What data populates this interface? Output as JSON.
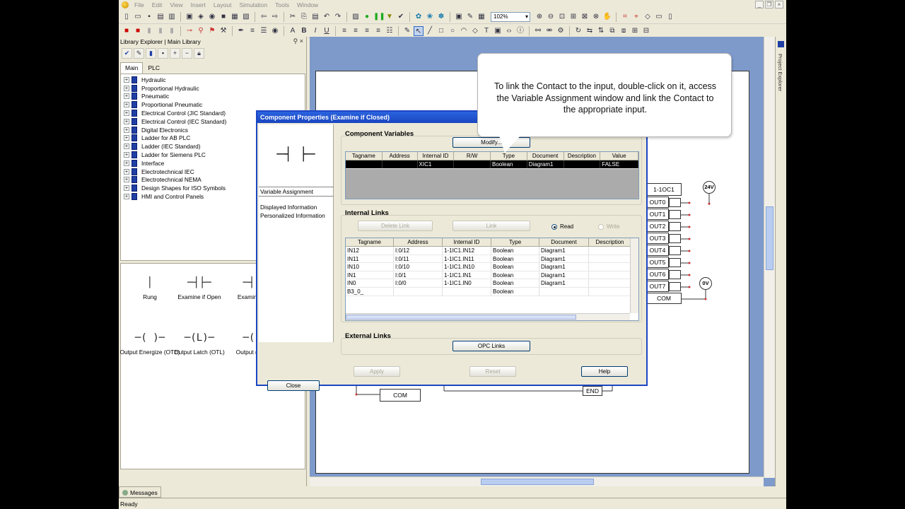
{
  "menu": [
    "File",
    "Edit",
    "View",
    "Insert",
    "Layout",
    "Simulation",
    "Tools",
    "Window"
  ],
  "toolbar": {
    "zoom": "102%"
  },
  "library": {
    "title": "Library Explorer | Main Library",
    "tabs": [
      "Main",
      "PLC"
    ],
    "tree": [
      "Hydraulic",
      "Proportional Hydraulic",
      "Pneumatic",
      "Proportional Pneumatic",
      "Electrical Control (JIC Standard)",
      "Electrical Control (IEC Standard)",
      "Digital Electronics",
      "Ladder for AB PLC",
      "Ladder (IEC Standard)",
      "Ladder for Siemens PLC",
      "Interface",
      "Electrotechnical IEC",
      "Electrotechnical NEMA",
      "Design Shapes for ISO Symbols",
      "HMI and Control Panels"
    ],
    "shapes": [
      {
        "label": "Rung",
        "symbol": "│"
      },
      {
        "label": "Examine if Open",
        "symbol": "─┤├─"
      },
      {
        "label": "Examine",
        "symbol": "─┤"
      },
      {
        "label": "Output Energize (OTE)",
        "symbol": "─( )─"
      },
      {
        "label": "Output Latch (OTL)",
        "symbol": "─(L)─"
      },
      {
        "label": "Output (O",
        "symbol": "─("
      }
    ]
  },
  "messages_tab": "Messages",
  "status": "Ready",
  "project_explorer": "Project Explorer",
  "diagram": {
    "module": "1-1OC1",
    "outputs": [
      "OUT0",
      "OUT1",
      "OUT2",
      "OUT3",
      "OUT4",
      "OUT5",
      "OUT6",
      "OUT7"
    ],
    "com": "COM",
    "supply_24v": "24V",
    "supply_0v": "0V",
    "com_bottom": "COM",
    "end": "END"
  },
  "dialog": {
    "title": "Component Properties (Examine if Closed)",
    "preview_symbol": "─┤ ├─",
    "nav": [
      "Variable Assignment",
      "Displayed Information",
      "Personalized Information"
    ],
    "close": "Close",
    "component_variables": {
      "title": "Component Variables",
      "modify": "Modify...",
      "columns": [
        "Tagname",
        "Address",
        "Internal ID",
        "R/W",
        "Type",
        "Document",
        "Description",
        "Value"
      ],
      "rows": [
        [
          "",
          "",
          "XIC1",
          "",
          "Boolean",
          "Diagram1",
          "",
          "FALSE"
        ]
      ]
    },
    "internal_links": {
      "title": "Internal Links",
      "delete_link": "Delete Link",
      "link": "Link",
      "read": "Read",
      "write": "Write",
      "columns": [
        "Tagname",
        "Address",
        "Internal ID",
        "Type",
        "Document",
        "Description"
      ],
      "rows": [
        [
          "IN12",
          "I:0/12",
          "1-1IC1.IN12",
          "Boolean",
          "Diagram1",
          ""
        ],
        [
          "IN11",
          "I:0/11",
          "1-1IC1.IN11",
          "Boolean",
          "Diagram1",
          ""
        ],
        [
          "IN10",
          "I:0/10",
          "1-1IC1.IN10",
          "Boolean",
          "Diagram1",
          ""
        ],
        [
          "IN1",
          "I:0/1",
          "1-1IC1.IN1",
          "Boolean",
          "Diagram1",
          ""
        ],
        [
          "IN0",
          "I:0/0",
          "1-1IC1.IN0",
          "Boolean",
          "Diagram1",
          ""
        ],
        [
          "B3_0_",
          "",
          "",
          "Boolean",
          "",
          ""
        ]
      ]
    },
    "external_links": {
      "title": "External Links",
      "opc": "OPC Links"
    },
    "apply": "Apply",
    "reset": "Reset",
    "help": "Help"
  },
  "bubble": {
    "text": "To link the Contact to the input, double-click on it, access the Variable Assignment window and link the Contact to the appropriate input."
  },
  "colors": {
    "title_bar": "#1a45c0",
    "canvas_bg": "#7e9acb",
    "selected_row": "#000000"
  }
}
